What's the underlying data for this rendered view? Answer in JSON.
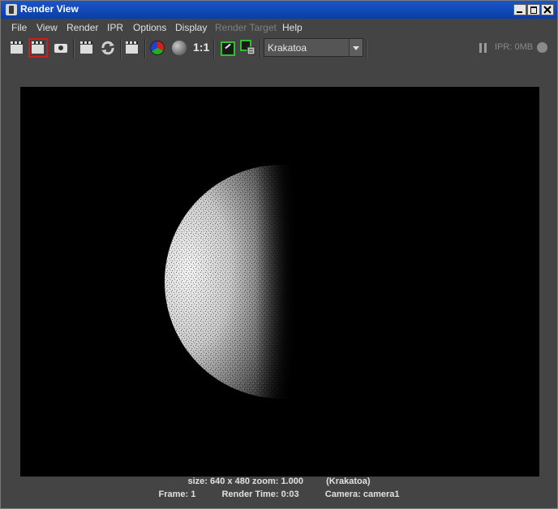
{
  "window": {
    "title": "Render View"
  },
  "menu": [
    "File",
    "View",
    "Render",
    "IPR",
    "Options",
    "Display",
    "Render Target",
    "Help"
  ],
  "toolbar": {
    "ratio_label": "1:1",
    "renderer": "Krakatoa",
    "ipr_label": "IPR: 0MB"
  },
  "status": {
    "line1_size": "size: 640 x 480 zoom: 1.000",
    "line1_renderer": "(Krakatoa)",
    "line2_frame": "Frame: 1",
    "line2_time": "Render Time: 0:03",
    "line2_camera": "Camera: camera1"
  },
  "render_image": {
    "subject": "half-lit particle sphere",
    "background": "#000000",
    "highlight": "#e8e8e8"
  },
  "colors": {
    "titlebar": "#0a3ea8",
    "panel": "#444444",
    "selected_outline": "#c82020"
  }
}
